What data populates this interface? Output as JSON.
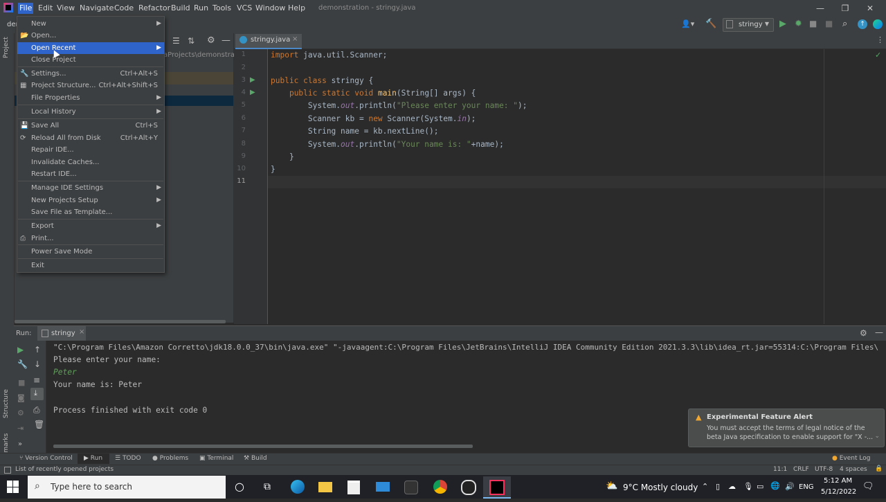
{
  "window": {
    "title": "demonstration - stringy.java",
    "menu": [
      "File",
      "Edit",
      "View",
      "Navigate",
      "Code",
      "Refactor",
      "Build",
      "Run",
      "Tools",
      "VCS",
      "Window",
      "Help"
    ],
    "controls": [
      "—",
      "❐",
      "✕"
    ]
  },
  "navbar": {
    "project_crumb": "der",
    "run_config": "stringy"
  },
  "project_panel": {
    "stripe_label": "Project",
    "path_fragment": "aProjects\\demonstrati"
  },
  "editor": {
    "tab_label": "stringy.java",
    "line_numbers": [
      "1",
      "2",
      "3",
      "4",
      "5",
      "6",
      "7",
      "8",
      "9",
      "10",
      "11"
    ]
  },
  "file_menu": {
    "items": [
      {
        "label": "New",
        "shortcut": "",
        "submenu": true
      },
      {
        "label": "Open...",
        "shortcut": "",
        "submenu": false
      },
      {
        "label": "Open Recent",
        "shortcut": "",
        "submenu": true
      },
      {
        "label": "Close Project",
        "shortcut": "",
        "submenu": false
      },
      {
        "label": "Settings...",
        "shortcut": "Ctrl+Alt+S",
        "submenu": false
      },
      {
        "label": "Project Structure...",
        "shortcut": "Ctrl+Alt+Shift+S",
        "submenu": false
      },
      {
        "label": "File Properties",
        "shortcut": "",
        "submenu": true
      },
      {
        "label": "Local History",
        "shortcut": "",
        "submenu": true
      },
      {
        "label": "Save All",
        "shortcut": "Ctrl+S",
        "submenu": false
      },
      {
        "label": "Reload All from Disk",
        "shortcut": "Ctrl+Alt+Y",
        "submenu": false
      },
      {
        "label": "Repair IDE...",
        "shortcut": "",
        "submenu": false
      },
      {
        "label": "Invalidate Caches...",
        "shortcut": "",
        "submenu": false
      },
      {
        "label": "Restart IDE...",
        "shortcut": "",
        "submenu": false
      },
      {
        "label": "Manage IDE Settings",
        "shortcut": "",
        "submenu": true
      },
      {
        "label": "New Projects Setup",
        "shortcut": "",
        "submenu": true
      },
      {
        "label": "Save File as Template...",
        "shortcut": "",
        "submenu": false
      },
      {
        "label": "Export",
        "shortcut": "",
        "submenu": true
      },
      {
        "label": "Print...",
        "shortcut": "",
        "submenu": false
      },
      {
        "label": "Power Save Mode",
        "shortcut": "",
        "submenu": false
      },
      {
        "label": "Exit",
        "shortcut": "",
        "submenu": false
      }
    ]
  },
  "run_panel": {
    "label": "Run:",
    "tab": "stringy",
    "output": [
      "\"C:\\Program Files\\Amazon Corretto\\jdk18.0.0_37\\bin\\java.exe\" \"-javaagent:C:\\Program Files\\JetBrains\\IntelliJ IDEA Community Edition 2021.3.3\\lib\\idea_rt.jar=55314:C:\\Program Files\\",
      "Please enter your name:",
      "Peter",
      "Your name is: Peter",
      "",
      "Process finished with exit code 0"
    ],
    "side_labels": [
      "Structure",
      "Bookmarks"
    ]
  },
  "tool_windows": {
    "version_control": "Version Control",
    "run": "Run",
    "todo": "TODO",
    "problems": "Problems",
    "terminal": "Terminal",
    "build": "Build",
    "event_log": "Event Log"
  },
  "status_bar": {
    "message": "List of recently opened projects",
    "position": "11:1",
    "line_sep": "CRLF",
    "encoding": "UTF-8",
    "indent": "4 spaces"
  },
  "notification": {
    "title": "Experimental Feature Alert",
    "body_line1": "You must accept the terms of legal notice of the",
    "body_line2": "beta Java specification to enable support for \"X -..."
  },
  "taskbar": {
    "search_placeholder": "Type here to search",
    "weather": "9°C  Mostly cloudy",
    "language": "ENG",
    "time": "5:12 AM",
    "date": "5/12/2022"
  },
  "colors": {
    "accent": "#2f65ca",
    "background": "#2b2b2b",
    "panel": "#3c3f41"
  }
}
